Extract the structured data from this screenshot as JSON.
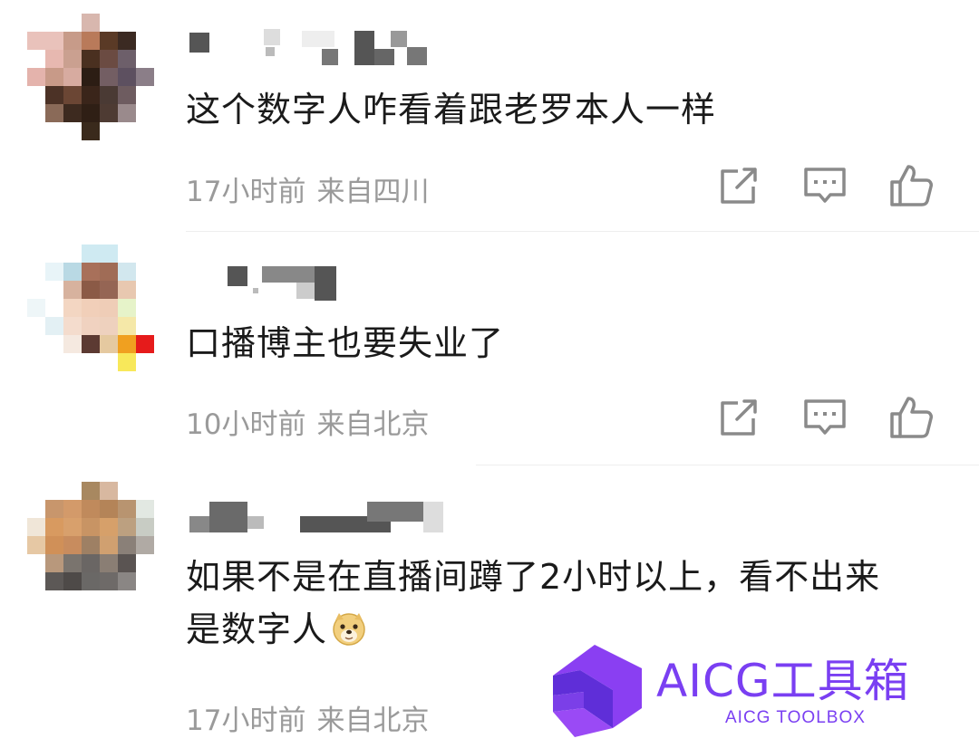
{
  "comments": [
    {
      "text": "这个数字人咋看着跟老罗本人一样",
      "time": "17小时前",
      "location": "来自四川"
    },
    {
      "text": "口播博主也要失业了",
      "time": "10小时前",
      "location": "来自北京"
    },
    {
      "text_line1": "如果不是在直播间蹲了2小时以上，看不出来",
      "text_line2": "是数字人",
      "emoji": "doge-emoji",
      "time": "17小时前",
      "location": "来自北京"
    }
  ],
  "actions": {
    "share_icon": "share-icon",
    "comment_icon": "comment-icon",
    "like_icon": "thumbs-up-icon"
  },
  "watermark": {
    "title": "AICG工具箱",
    "subtitle": "AICG TOOLBOX",
    "color": "#7a3ff2"
  },
  "colors": {
    "text": "#1a1a1a",
    "meta": "#9a9a9a",
    "icon": "#8a8a8a",
    "divider": "#eeeeee"
  }
}
